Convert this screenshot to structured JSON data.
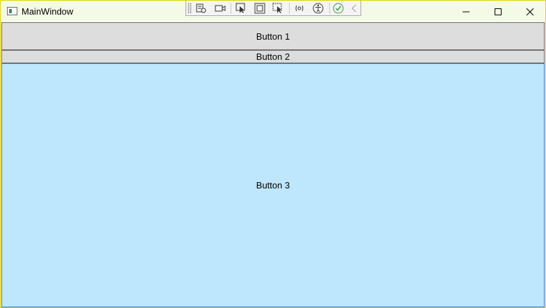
{
  "window": {
    "title": "MainWindow"
  },
  "debug_toolbar": {
    "icons": [
      "select-element-icon",
      "record-icon",
      "inspect-pointer-icon",
      "layout-adorner-icon",
      "track-focus-icon",
      "hot-reload-icon",
      "accessibility-icon",
      "check-icon",
      "collapse-icon"
    ]
  },
  "window_controls": {
    "minimize": "minimize-icon",
    "maximize": "maximize-icon",
    "close": "close-icon"
  },
  "buttons": {
    "b1": "Button 1",
    "b2": "Button 2",
    "b3": "Button 3"
  },
  "colors": {
    "titlebar": "#f3fae6",
    "button_default": "#dddddd",
    "button_hover": "#bee6fd",
    "window_border": "#e6d200"
  }
}
